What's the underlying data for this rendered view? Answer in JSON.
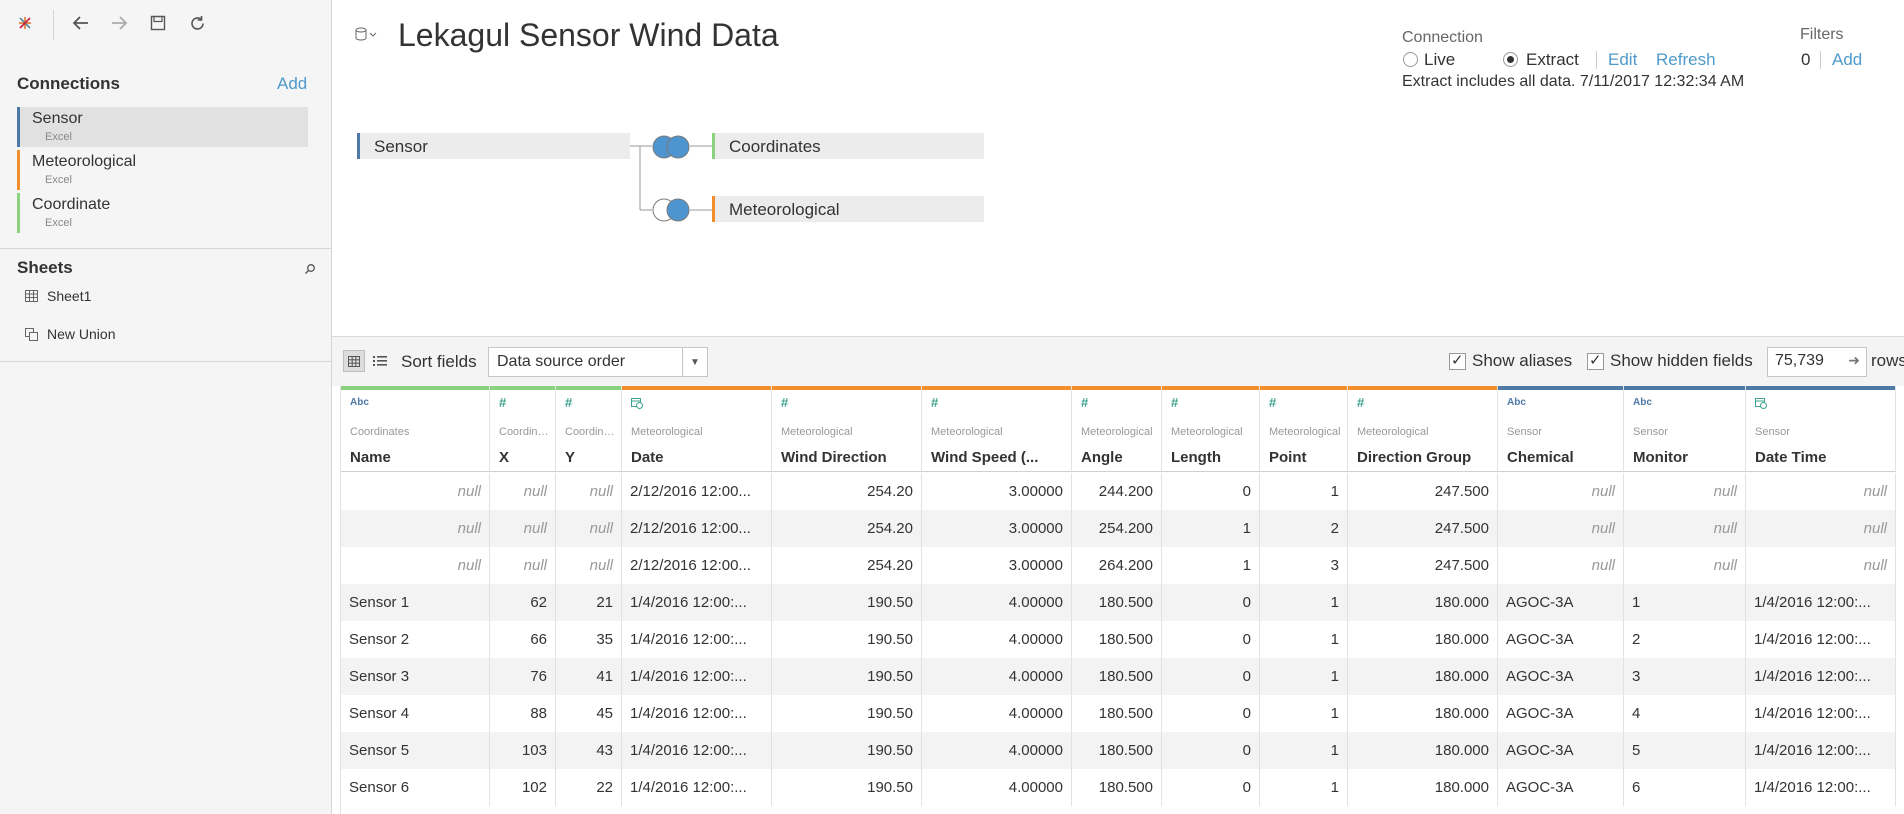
{
  "toolbar": {
    "icons": [
      "tableau-logo-icon",
      "back-icon",
      "forward-icon",
      "save-icon",
      "refresh-icon"
    ]
  },
  "connections": {
    "title": "Connections",
    "add_label": "Add",
    "items": [
      {
        "name": "Sensor",
        "type": "Excel",
        "color": "#4e79a7"
      },
      {
        "name": "Meteorological",
        "type": "Excel",
        "color": "#f28e2b"
      },
      {
        "name": "Coordinate",
        "type": "Excel",
        "color": "#8cd17d"
      }
    ]
  },
  "sheets": {
    "title": "Sheets",
    "items": [
      {
        "label": "Sheet1"
      },
      {
        "label": "New Union"
      }
    ]
  },
  "datasource": {
    "title": "Lekagul Sensor Wind Data",
    "connection_label": "Connection",
    "live_label": "Live",
    "extract_label": "Extract",
    "edit_label": "Edit",
    "refresh_label": "Refresh",
    "extract_info": "Extract includes all data. 7/11/2017 12:32:34 AM",
    "filters_label": "Filters",
    "filters_count": "0",
    "filters_add": "Add",
    "tables": {
      "left": "Sensor",
      "join1": "Coordinates",
      "join2": "Meteorological"
    },
    "colors": {
      "sensor": "#4e79a7",
      "meteo": "#f28e2b",
      "coord": "#8cd17d",
      "join": "#4e95cf"
    }
  },
  "grid_toolbar": {
    "sort_label": "Sort fields",
    "sort_value": "Data source order",
    "show_aliases": "Show aliases",
    "show_hidden": "Show hidden fields",
    "rows_value": "75,739",
    "rows_label": "rows"
  },
  "grid": {
    "columns": [
      {
        "type": "Abc",
        "source": "Coordinates",
        "name": "Name"
      },
      {
        "type": "#",
        "source": "Coordinates",
        "name": "X"
      },
      {
        "type": "#",
        "source": "Coordinates",
        "name": "Y"
      },
      {
        "type": "date",
        "source": "Meteorological",
        "name": "Date"
      },
      {
        "type": "#",
        "source": "Meteorological",
        "name": "Wind Direction"
      },
      {
        "type": "#",
        "source": "Meteorological",
        "name": "Wind Speed (..."
      },
      {
        "type": "#",
        "source": "Meteorological",
        "name": "Angle"
      },
      {
        "type": "#",
        "source": "Meteorological",
        "name": "Length"
      },
      {
        "type": "#",
        "source": "Meteorological",
        "name": "Point"
      },
      {
        "type": "#",
        "source": "Meteorological",
        "name": "Direction Group"
      },
      {
        "type": "Abc",
        "source": "Sensor",
        "name": "Chemical"
      },
      {
        "type": "Abc",
        "source": "Sensor",
        "name": "Monitor"
      },
      {
        "type": "date",
        "source": "Sensor",
        "name": "Date Time"
      }
    ],
    "rows": [
      [
        "null",
        "null",
        "null",
        "2/12/2016 12:00...",
        "254.20",
        "3.00000",
        "244.200",
        "0",
        "1",
        "247.500",
        "null",
        "null",
        "null"
      ],
      [
        "null",
        "null",
        "null",
        "2/12/2016 12:00...",
        "254.20",
        "3.00000",
        "254.200",
        "1",
        "2",
        "247.500",
        "null",
        "null",
        "null"
      ],
      [
        "null",
        "null",
        "null",
        "2/12/2016 12:00...",
        "254.20",
        "3.00000",
        "264.200",
        "1",
        "3",
        "247.500",
        "null",
        "null",
        "null"
      ],
      [
        "Sensor 1",
        "62",
        "21",
        "1/4/2016 12:00:...",
        "190.50",
        "4.00000",
        "180.500",
        "0",
        "1",
        "180.000",
        "AGOC-3A",
        "1",
        "1/4/2016 12:00:..."
      ],
      [
        "Sensor 2",
        "66",
        "35",
        "1/4/2016 12:00:...",
        "190.50",
        "4.00000",
        "180.500",
        "0",
        "1",
        "180.000",
        "AGOC-3A",
        "2",
        "1/4/2016 12:00:..."
      ],
      [
        "Sensor 3",
        "76",
        "41",
        "1/4/2016 12:00:...",
        "190.50",
        "4.00000",
        "180.500",
        "0",
        "1",
        "180.000",
        "AGOC-3A",
        "3",
        "1/4/2016 12:00:..."
      ],
      [
        "Sensor 4",
        "88",
        "45",
        "1/4/2016 12:00:...",
        "190.50",
        "4.00000",
        "180.500",
        "0",
        "1",
        "180.000",
        "AGOC-3A",
        "4",
        "1/4/2016 12:00:..."
      ],
      [
        "Sensor 5",
        "103",
        "43",
        "1/4/2016 12:00:...",
        "190.50",
        "4.00000",
        "180.500",
        "0",
        "1",
        "180.000",
        "AGOC-3A",
        "5",
        "1/4/2016 12:00:..."
      ],
      [
        "Sensor 6",
        "102",
        "22",
        "1/4/2016 12:00:...",
        "190.50",
        "4.00000",
        "180.500",
        "0",
        "1",
        "180.000",
        "AGOC-3A",
        "6",
        "1/4/2016 12:00:..."
      ]
    ]
  }
}
